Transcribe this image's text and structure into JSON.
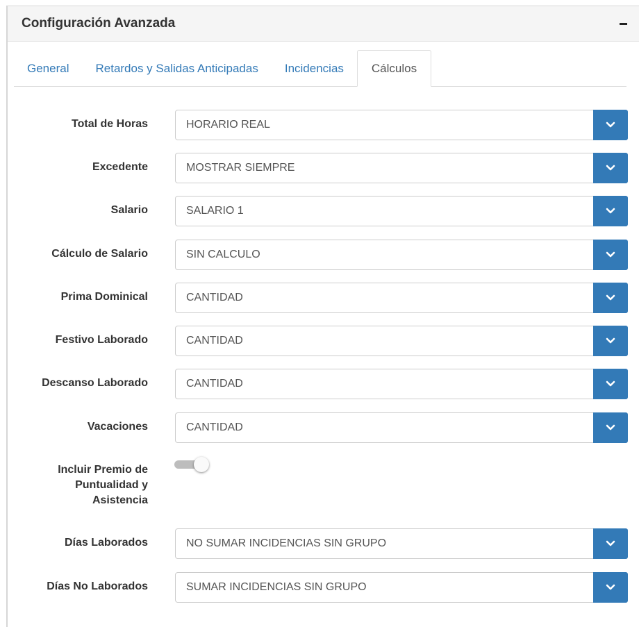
{
  "panel": {
    "title": "Configuración Avanzada",
    "collapse_icon": "minus-icon"
  },
  "tabs": [
    {
      "label": "General",
      "active": false
    },
    {
      "label": "Retardos y Salidas Anticipadas",
      "active": false
    },
    {
      "label": "Incidencias",
      "active": false
    },
    {
      "label": "Cálculos",
      "active": true
    }
  ],
  "fields": {
    "total_horas": {
      "label": "Total de Horas",
      "value": "HORARIO REAL"
    },
    "excedente": {
      "label": "Excedente",
      "value": "MOSTRAR SIEMPRE"
    },
    "salario": {
      "label": "Salario",
      "value": "SALARIO 1"
    },
    "calculo_salario": {
      "label": "Cálculo de Salario",
      "value": "SIN CALCULO"
    },
    "prima_dominical": {
      "label": "Prima Dominical",
      "value": "CANTIDAD"
    },
    "festivo_laborado": {
      "label": "Festivo Laborado",
      "value": "CANTIDAD"
    },
    "descanso_laborado": {
      "label": "Descanso Laborado",
      "value": "CANTIDAD"
    },
    "vacaciones": {
      "label": "Vacaciones",
      "value": "CANTIDAD"
    },
    "premio": {
      "label_lines": [
        "Incluir Premio de",
        "Puntualidad y",
        "Asistencia"
      ],
      "enabled": false
    },
    "dias_laborados": {
      "label": "Días Laborados",
      "value": "NO SUMAR INCIDENCIAS SIN GRUPO"
    },
    "dias_no_laborados": {
      "label": "Días No Laborados",
      "value": "SUMAR INCIDENCIAS SIN GRUPO"
    }
  },
  "colors": {
    "accent": "#337ab7",
    "link": "#337ab7",
    "toggle_off": "#bdbdbd"
  }
}
